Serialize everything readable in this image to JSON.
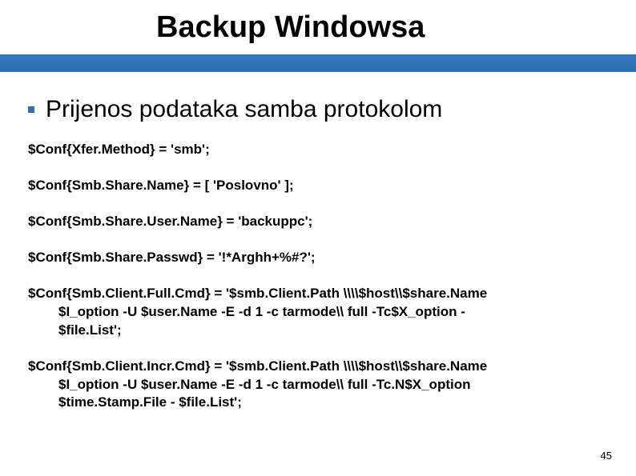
{
  "slide": {
    "title": "Backup Windowsa",
    "bullet": "Prijenos podataka samba protokolom",
    "conf1": "$Conf{Xfer.Method} = 'smb';",
    "conf2": "$Conf{Smb.Share.Name} = [ 'Poslovno' ];",
    "conf3": "$Conf{Smb.Share.User.Name} = 'backuppc';",
    "conf4": "$Conf{Smb.Share.Passwd} = '!*Arghh+%#?';",
    "conf5a": "$Conf{Smb.Client.Full.Cmd} = '$smb.Client.Path \\\\\\\\$host\\\\$share.Name",
    "conf5b": "$I_option -U $user.Name -E -d 1 -c tarmode\\\\ full -Tc$X_option -",
    "conf5c": "$file.List';",
    "conf6a": "$Conf{Smb.Client.Incr.Cmd} = '$smb.Client.Path \\\\\\\\$host\\\\$share.Name",
    "conf6b": "$I_option -U $user.Name -E -d 1 -c tarmode\\\\ full -Tc.N$X_option",
    "conf6c": "$time.Stamp.File - $file.List';",
    "page_number": "45"
  }
}
